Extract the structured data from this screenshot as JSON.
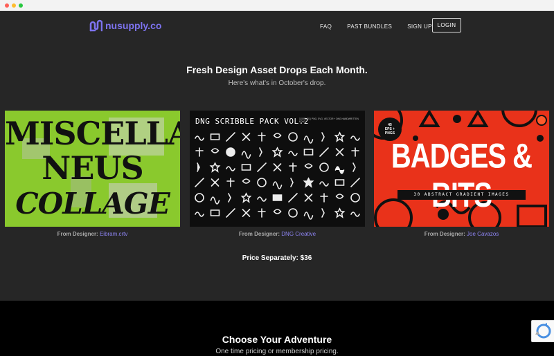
{
  "browser": {
    "dots": [
      "#fe5f57",
      "#febc2e",
      "#28c840"
    ]
  },
  "header": {
    "logo_text": "nusupply.co",
    "nav": [
      "FAQ",
      "PAST BUNDLES",
      "SIGN UP"
    ],
    "login_label": "LOGIN"
  },
  "hero": {
    "title": "Fresh Design Asset Drops Each Month.",
    "subtitle": "Here's what's in October's drop."
  },
  "products": [
    {
      "title_lines": [
        "MISCELLA",
        "NEUS",
        "COLLAGE"
      ],
      "credit_prefix": "From Designer:",
      "designer": "Eibram.crtv"
    },
    {
      "title": "DNG SCRIBBLE PACK VOL.2",
      "tagline": "115 FILES | PNG, SVG, VECTOR + DNG HANDWRITTEN FONT",
      "credit_prefix": "From Designer:",
      "designer": "DNG Creative"
    },
    {
      "badge_top": "45",
      "badge_mid": "EPS +",
      "badge_bottom": "PNGS",
      "title": "BADGES & BITS",
      "tagline": "30 ABSTRACT GRADIENT IMAGES",
      "credit_prefix": "From Designer:",
      "designer": "Joe Cavazos"
    }
  ],
  "price_text": "Price Separately: $36",
  "adventure": {
    "title": "Choose Your Adventure",
    "subtitle": "One time pricing or membership pricing."
  },
  "colors": {
    "brand": "#7d73ef",
    "card1_bg": "#8ac92d",
    "card3_bg": "#e9321a"
  },
  "icons": [
    "recaptcha-icon"
  ]
}
